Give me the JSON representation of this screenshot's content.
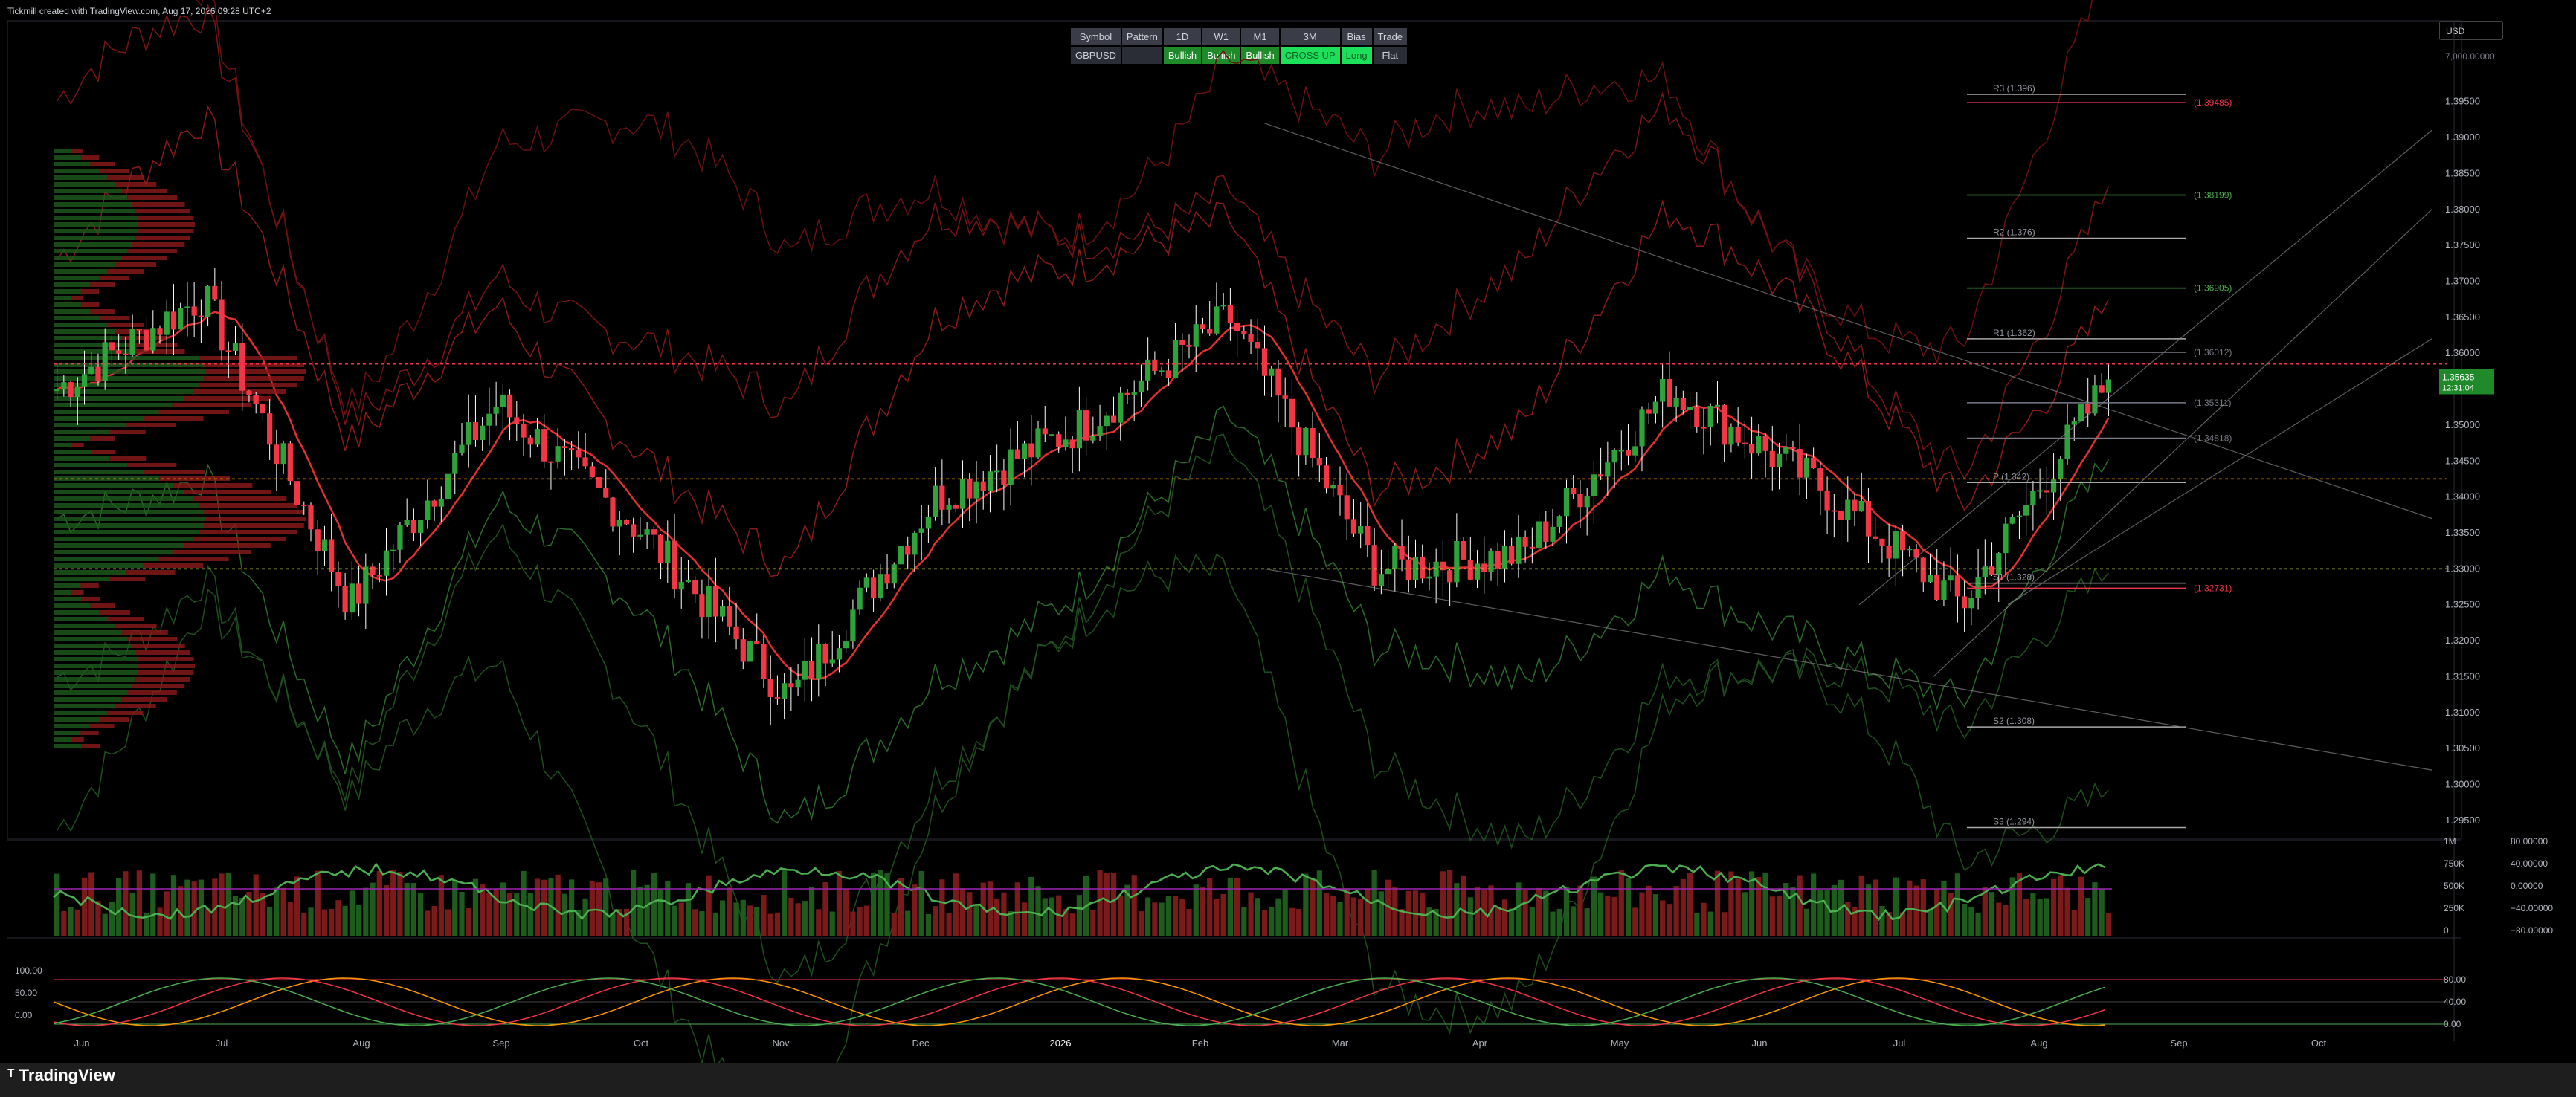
{
  "header": {
    "text": "Tickmill created with TradingView.com, Aug 17, 2026 09:28 UTC+2"
  },
  "currency_select": "USD",
  "table": {
    "headers": [
      "Symbol",
      "Pattern",
      "1D",
      "W1",
      "M1",
      "3M",
      "Bias",
      "Trade"
    ],
    "row": [
      "GBPUSD",
      "-",
      "Bullish",
      "Bullish",
      "Bullish",
      "CROSS UP",
      "Long",
      "Flat"
    ]
  },
  "price_axis": {
    "top_label": "7,000.00000",
    "ticks": [
      "1.39500",
      "1.39000",
      "1.38500",
      "1.38000",
      "1.37500",
      "1.37000",
      "1.36500",
      "1.36000",
      "1.35500",
      "1.35000",
      "1.34500",
      "1.34000",
      "1.33500",
      "1.33000",
      "1.32500",
      "1.32000",
      "1.31500",
      "1.31000",
      "1.30500",
      "1.30000",
      "1.29500"
    ],
    "current_price": "1.35635",
    "countdown": "12:31:04"
  },
  "levels": [
    {
      "label": "R3 (1.396)",
      "price": 1.396
    },
    {
      "label": "R2 (1.376)",
      "price": 1.376
    },
    {
      "label": "R1 (1.362)",
      "price": 1.362
    },
    {
      "label": "P (1.342)",
      "price": 1.342
    },
    {
      "label": "S1 (1.328)",
      "price": 1.328
    },
    {
      "label": "S2 (1.308)",
      "price": 1.308
    },
    {
      "label": "S3 (1.294)",
      "price": 1.294
    }
  ],
  "targets": [
    {
      "label": "(1.39485)",
      "price": 1.39485,
      "color": "#f23645"
    },
    {
      "label": "(1.38199)",
      "price": 1.38199,
      "color": "#4caf50"
    },
    {
      "label": "(1.36905)",
      "price": 1.36905,
      "color": "#4caf50"
    },
    {
      "label": "(1.36012)",
      "price": 1.36012,
      "color": "#787b86"
    },
    {
      "label": "(1.35311)",
      "price": 1.35311,
      "color": "#787b86"
    },
    {
      "label": "(1.34818)",
      "price": 1.34818,
      "color": "#787b86"
    },
    {
      "label": "(1.32731)",
      "price": 1.32731,
      "color": "#f23645"
    }
  ],
  "volume_axis": [
    "1M",
    "750K",
    "500K",
    "250K",
    "0"
  ],
  "osc1_axis": [
    "80.00000",
    "40.00000",
    "0.00000",
    "−40.00000",
    "−80.00000"
  ],
  "osc2_left_axis": [
    "100.00",
    "50.00",
    "0.00"
  ],
  "osc2_right_axis": [
    "80.00",
    "40.00",
    "0.00"
  ],
  "time_axis": [
    "Jun",
    "Jul",
    "Aug",
    "Sep",
    "Oct",
    "Nov",
    "Dec",
    "2026",
    "Feb",
    "Mar",
    "Apr",
    "May",
    "Jun",
    "Jul",
    "Aug",
    "Sep",
    "Oct"
  ],
  "footer": {
    "logo": "TradingView"
  },
  "chart_data": {
    "type": "candlestick",
    "symbol": "GBPUSD",
    "ylim": [
      1.2925,
      1.399
    ],
    "monthly_closes": [
      {
        "x": "Jun",
        "y": 1.355
      },
      {
        "x": "Jul",
        "y": 1.368
      },
      {
        "x": "Aug",
        "y": 1.325
      },
      {
        "x": "Sep",
        "y": 1.353
      },
      {
        "x": "Oct",
        "y": 1.335
      },
      {
        "x": "Nov",
        "y": 1.312
      },
      {
        "x": "Dec",
        "y": 1.34
      },
      {
        "x": "2026",
        "y": 1.35
      },
      {
        "x": "Feb",
        "y": 1.365
      },
      {
        "x": "Mar",
        "y": 1.33
      },
      {
        "x": "Apr",
        "y": 1.332
      },
      {
        "x": "May",
        "y": 1.355
      },
      {
        "x": "Jun",
        "y": 1.342
      },
      {
        "x": "Jul",
        "y": 1.325
      },
      {
        "x": "Aug",
        "y": 1.3563
      }
    ],
    "current": 1.35635
  },
  "colors": {
    "up": "#1e8c2a",
    "down": "#f23645",
    "bg": "#000000"
  }
}
